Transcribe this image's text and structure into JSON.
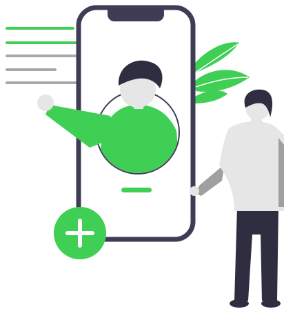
{
  "illustration": {
    "subject": "person-adding-contact-on-phone",
    "icons": {
      "add": "plus-icon",
      "plant": "leaf-icon"
    },
    "colors": {
      "accent_green": "#3fcf55",
      "phone_frame": "#3f3d56",
      "text_line_grey": "#a9a9a9",
      "skin": "#e6e6e6",
      "hair": "#2f2e41",
      "shirt": "#e6e6e6",
      "sleeve": "#a0a0a0",
      "pants": "#2f2e41"
    }
  }
}
